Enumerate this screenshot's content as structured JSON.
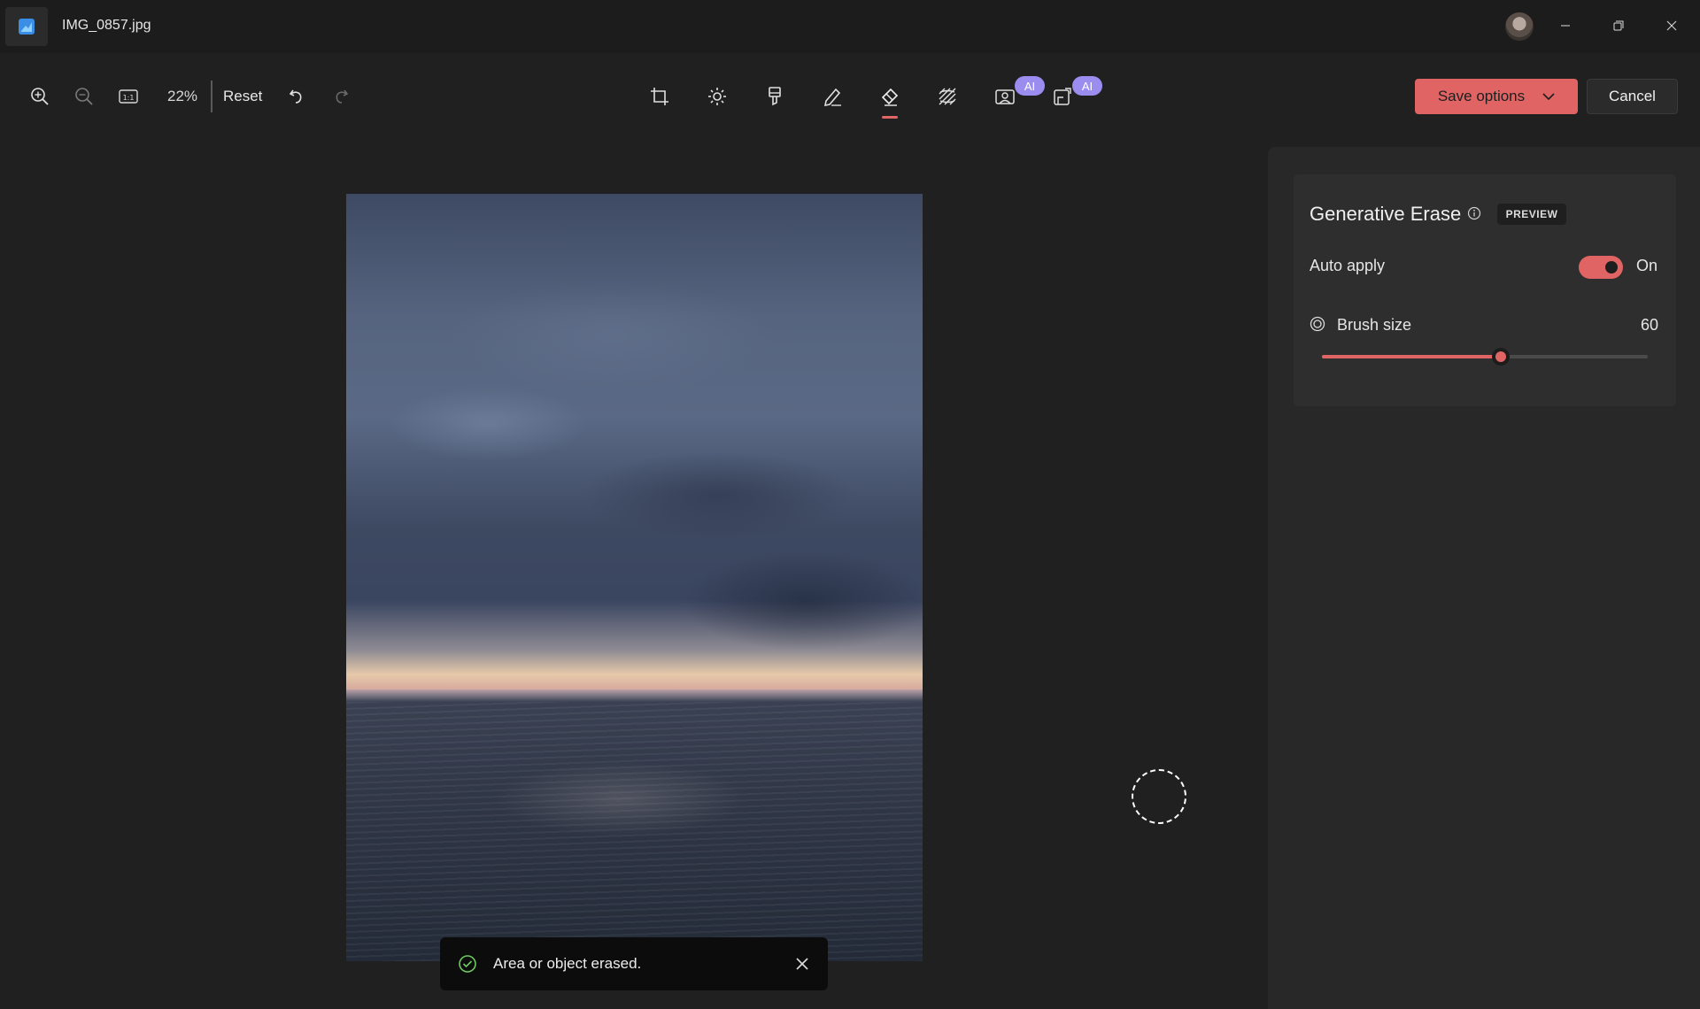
{
  "titlebar": {
    "filename": "IMG_0857.jpg",
    "app_icon": "photos-app-icon",
    "controls": [
      "minimize-icon",
      "restore-icon",
      "close-icon"
    ]
  },
  "toolbar": {
    "zoom_level": "22%",
    "reset_label": "Reset",
    "left_icons": [
      "zoom-in-icon",
      "zoom-out-icon",
      "actual-size-icon",
      "undo-icon",
      "redo-icon"
    ],
    "tools": [
      {
        "name": "crop-icon"
      },
      {
        "name": "adjust-icon"
      },
      {
        "name": "filter-icon"
      },
      {
        "name": "markup-icon"
      },
      {
        "name": "erase-icon",
        "active": true
      },
      {
        "name": "blur-background-icon"
      },
      {
        "name": "remove-background-icon",
        "badge": "AI"
      },
      {
        "name": "relight-icon",
        "badge": "AI"
      }
    ],
    "save_label": "Save options",
    "cancel_label": "Cancel"
  },
  "toast": {
    "message": "Area or object erased."
  },
  "panel": {
    "title": "Generative Erase",
    "badge": "PREVIEW",
    "auto_apply_label": "Auto apply",
    "auto_apply_state": "On",
    "auto_apply_on": true,
    "brush_size_label": "Brush size",
    "brush_size_value": "60",
    "brush_size_fraction": 0.55
  },
  "colors": {
    "accent": "#e06464",
    "ai_badge": "#9b8cf0",
    "background": "#202020",
    "panel": "#282828"
  }
}
